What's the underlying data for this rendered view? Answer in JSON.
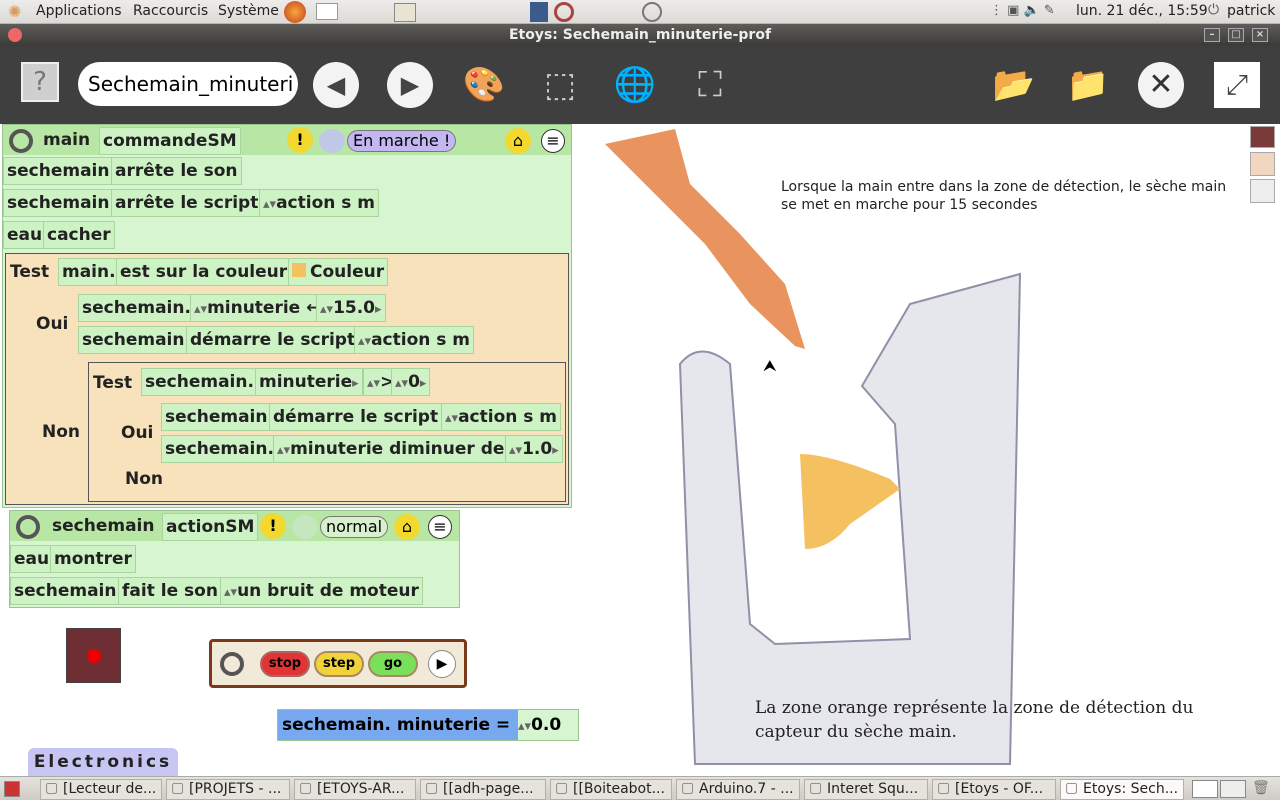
{
  "topbar": {
    "applications": "Applications",
    "raccourcis": "Raccourcis",
    "systeme": "Système",
    "datetime": "lun. 21 déc., 15:59",
    "user": "patrick"
  },
  "window": {
    "title": "Etoys: Sechemain_minuterie-prof"
  },
  "toolbar": {
    "help": "?",
    "project_name": "Sechemain_minuteri"
  },
  "world": {
    "script_main": {
      "object": "main",
      "name": "commandeSM",
      "status": "En marche !",
      "rows": [
        [
          "sechemain",
          "arrête le son"
        ],
        [
          "sechemain",
          "arrête le script",
          "action s m"
        ],
        [
          "eau",
          "cacher"
        ]
      ],
      "test1": {
        "test": "Test",
        "obj": "main.",
        "cond": "est sur la couleur",
        "color_label": "Couleur",
        "oui": "Oui",
        "non": "Non",
        "oui_row1": [
          "sechemain.",
          "minuterie",
          "←",
          "15.0"
        ],
        "oui_row2": [
          "sechemain",
          "démarre le script",
          "action s m"
        ],
        "test2": {
          "test": "Test",
          "obj": "sechemain.",
          "attr": "minuterie",
          "op": ">",
          "val": "0",
          "oui": "Oui",
          "non": "Non",
          "oui_row1": [
            "sechemain",
            "démarre le script",
            "action s m"
          ],
          "oui_row2": [
            "sechemain.",
            "minuterie diminuer de",
            "1.0"
          ]
        }
      }
    },
    "script_seche": {
      "object": "sechemain",
      "name": "actionSM",
      "status": "normal",
      "rows": [
        [
          "eau",
          "montrer"
        ],
        [
          "sechemain",
          "fait le son",
          "un bruit de moteur"
        ]
      ]
    },
    "controls": {
      "stop": "stop",
      "step": "step",
      "go": "go"
    },
    "watcher": {
      "label": "sechemain. minuterie =",
      "value": "0.0"
    },
    "flap": "Electronics",
    "text1": "Lorsque la main entre dans la zone de détection, le sèche main se met en marche pour 15 secondes",
    "text2": "La zone orange représente la zone de détection du capteur du sèche main."
  },
  "taskbar": {
    "items": [
      "[Lecteur de...",
      "[PROJETS - ...",
      "[ETOYS-AR...",
      "[[adh-page...",
      "[[Boiteabot...",
      "Arduino.7 - ...",
      "Interet Squ...",
      "[Etoys - OF...",
      "Etoys: Sech..."
    ]
  },
  "colors": {
    "accent_orange": "#f5c060",
    "tile_green": "#cdf2c4",
    "test_bg": "#f7e2bb",
    "toolbar": "#3f3f3f"
  }
}
